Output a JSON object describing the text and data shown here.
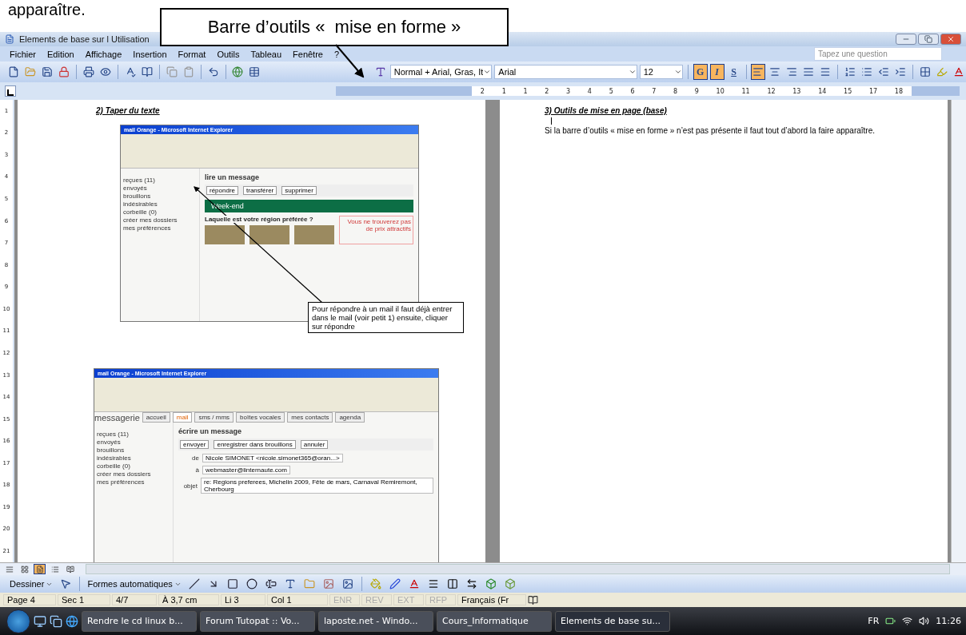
{
  "top_text": "apparaître.",
  "annotation_callout": "Barre d’outils «  mise en forme »",
  "window": {
    "title": "Elements de base sur l Utilisation"
  },
  "menu": [
    "Fichier",
    "Edition",
    "Affichage",
    "Insertion",
    "Format",
    "Outils",
    "Tableau",
    "Fenêtre",
    "?"
  ],
  "help_search": {
    "placeholder": "Tapez une question"
  },
  "formatting": {
    "style": "Normal + Arial, Gras, It",
    "font": "Arial",
    "size": "12",
    "bold_label": "G",
    "italic_label": "I",
    "underline_label": "S",
    "bold": true,
    "italic": true,
    "underline": false
  },
  "alignments": [
    {
      "kind": "left",
      "selected": true
    },
    {
      "kind": "center",
      "selected": false
    },
    {
      "kind": "right",
      "selected": false
    },
    {
      "kind": "justify",
      "selected": false
    }
  ],
  "ruler_numbers": [
    "2",
    "1",
    "1",
    "2",
    "3",
    "4",
    "5",
    "6",
    "7",
    "8",
    "9",
    "10",
    "11",
    "12",
    "13",
    "14",
    "15",
    "17",
    "18"
  ],
  "left_ruler_numbers": [
    "1",
    "2",
    "3",
    "4",
    "5",
    "6",
    "7",
    "8",
    "9",
    "10",
    "11",
    "12",
    "13",
    "14",
    "15",
    "16",
    "17",
    "18",
    "19",
    "20",
    "21"
  ],
  "page_left": {
    "heading": "2) Taper du texte",
    "note": "Pour répondre à un mail il faut déjà entrer dans le mail (voir petit 1) ensuite, cliquer sur répondre",
    "screenshot_read": {
      "title": "mail Orange - Microsoft Internet Explorer",
      "heading": "lire un message",
      "folders": [
        "reçues (11)",
        "envoyés",
        "brouillons",
        "indésirables",
        "corbeille (0)",
        "créer mes dossiers",
        "mes préférences"
      ],
      "buttons": [
        "répondre",
        "transférer",
        "supprimer"
      ],
      "banner": "Week-end",
      "question": "Laquelle est votre région préférée ?",
      "ad": "Vous ne trouverez pas de prix attractifs"
    },
    "screenshot_write": {
      "title": "mail Orange - Microsoft Internet Explorer",
      "brand": "messagerie",
      "tabs": [
        {
          "label": "accueil",
          "selected": false
        },
        {
          "label": "mail",
          "selected": true
        },
        {
          "label": "sms / mms",
          "selected": false
        },
        {
          "label": "boîtes vocales",
          "selected": false
        },
        {
          "label": "mes contacts",
          "selected": false
        },
        {
          "label": "agenda",
          "selected": false
        }
      ],
      "heading": "écrire un message",
      "folders": [
        "reçues (11)",
        "envoyés",
        "brouillons",
        "indésirables",
        "corbeille (0)",
        "créer mes dossiers",
        "mes préférences"
      ],
      "buttons": [
        "envoyer",
        "enregistrer dans brouillons",
        "annuler"
      ],
      "fields": [
        {
          "label": "de",
          "value": "Nicole SIMONET <nicole.simonet365@oran...>"
        },
        {
          "label": "à",
          "value": "webmaster@linternaute.com"
        },
        {
          "label": "objet",
          "value": "re: Regions preferees, Michelin 2009, Fête de mars, Carnaval Remiremont, Cherbourg"
        }
      ]
    }
  },
  "page_right": {
    "heading": "3) Outils de mise en page (base)",
    "paragraph": "Si la barre d’outils « mise en forme » n’est pas présente il faut tout d’abord la faire apparaître."
  },
  "view_buttons": [
    {
      "selected": false
    },
    {
      "selected": false
    },
    {
      "selected": true
    },
    {
      "selected": false
    },
    {
      "selected": false
    }
  ],
  "drawing_toolbar": {
    "draw": "Dessiner",
    "autoshapes": "Formes automatiques"
  },
  "status_bar": [
    "Page 4",
    "Sec 1",
    "4/7",
    "À 3,7 cm",
    "Li 3",
    "Col 1"
  ],
  "modes": [
    {
      "label": "ENR",
      "on": false
    },
    {
      "label": "REV",
      "on": false
    },
    {
      "label": "EXT",
      "on": false
    },
    {
      "label": "RFP",
      "on": false
    }
  ],
  "language": "Français (Fr",
  "taskbar": {
    "tasks": [
      {
        "label": "Rendre le cd linux b...",
        "selected": false
      },
      {
        "label": "Forum Tutopat :: Vo...",
        "selected": false
      },
      {
        "label": "laposte.net - Windo...",
        "selected": false
      },
      {
        "label": "Cours_Informatique",
        "selected": false
      },
      {
        "label": "Elements de base su...",
        "selected": true
      }
    ],
    "lang": "FR",
    "clock": "11:26"
  }
}
